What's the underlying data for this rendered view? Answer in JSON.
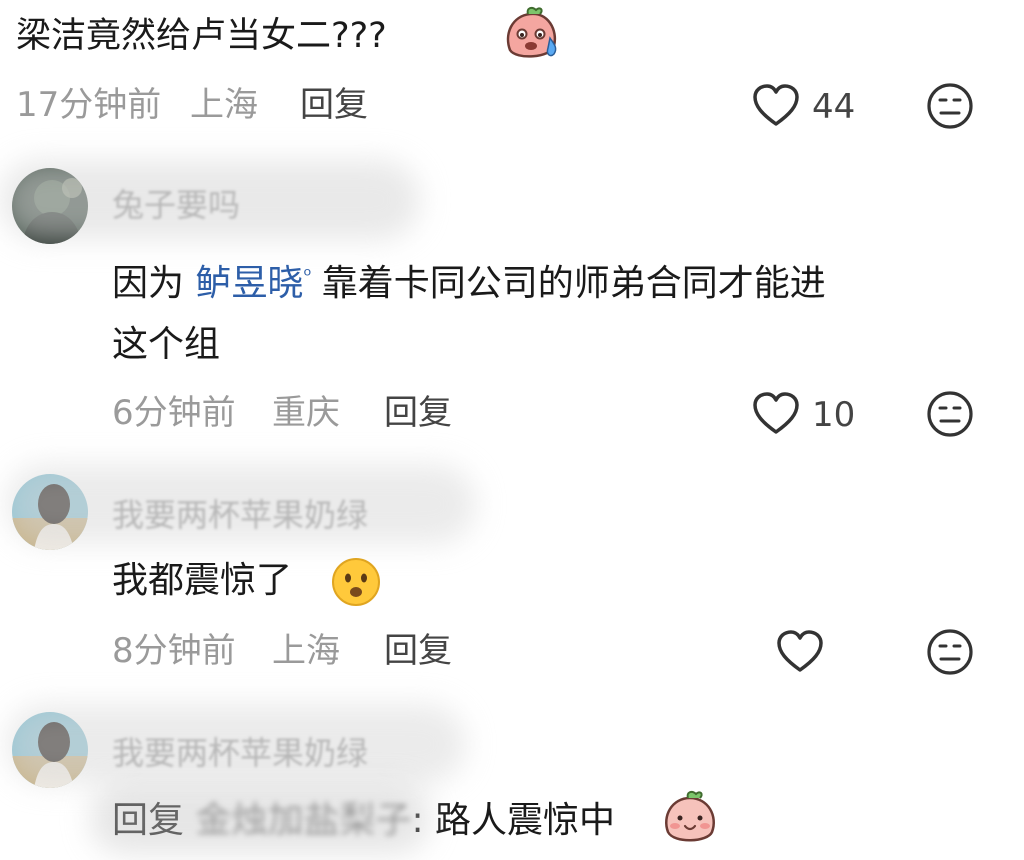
{
  "colors": {
    "text": "#1a1a1a",
    "meta": "#9a9a9a",
    "action": "#444444",
    "mention": "#2d5ea8",
    "background": "#ffffff"
  },
  "top_comment": {
    "text": "梁洁竟然给卢当女二???",
    "emoji": "sweating-blob-emoji",
    "time": "17分钟前",
    "location": "上海",
    "reply": "回复",
    "likes": "44"
  },
  "comments": [
    {
      "username": "兔子要吗",
      "text_prefix": "因为",
      "mention": "鲈昱晓",
      "text_suffix": "靠着卡同公司的师弟合同才能进",
      "text_line2": "这个组",
      "time": "6分钟前",
      "location": "重庆",
      "reply": "回复",
      "likes": "10"
    },
    {
      "username": "我要两杯苹果奶绿",
      "text": "我都震惊了",
      "emoji": "surprised-face-emoji",
      "time": "8分钟前",
      "location": "上海",
      "reply": "回复",
      "likes": ""
    },
    {
      "username": "我要两杯苹果奶绿",
      "reply_prefix": "回复",
      "reply_target": "金烛加盐梨子",
      "text": ": 路人震惊中",
      "emoji": "blushing-blob-emoji"
    }
  ],
  "icons": {
    "heart": "heart-outline-icon",
    "dislike": "meh-face-icon",
    "search": "search-icon"
  }
}
